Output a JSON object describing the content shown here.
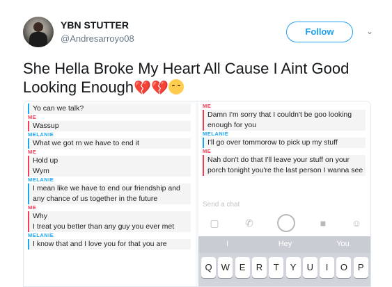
{
  "author": {
    "display_name": "YBN STUTTER",
    "handle": "@Andresarroyo08"
  },
  "follow_label": "Follow",
  "tweet": {
    "text": "She Hella Broke My Heart All Cause I Aint Good Looking Enough"
  },
  "left_chat": [
    {
      "sender": "",
      "role": "melanie",
      "text": "Yo can we talk?"
    },
    {
      "sender": "ME",
      "role": "me",
      "text": "Wassup"
    },
    {
      "sender": "MELANIE",
      "role": "melanie",
      "text": "What we got rn we have to end it"
    },
    {
      "sender": "ME",
      "role": "me",
      "text": "Hold up"
    },
    {
      "sender": "",
      "role": "me",
      "text": "Wym"
    },
    {
      "sender": "MELANIE",
      "role": "melanie",
      "text": "I mean like we have to end our friendship and any chance of us together in the future"
    },
    {
      "sender": "ME",
      "role": "me",
      "text": "Why"
    },
    {
      "sender": "",
      "role": "me",
      "text": "I treat you better than any guy you ever met"
    },
    {
      "sender": "MELANIE",
      "role": "melanie",
      "text": "I know that and I love you for that you are"
    }
  ],
  "right_chat": [
    {
      "sender": "ME",
      "role": "me",
      "text": "Damn I'm sorry that I couldn't be goo looking enough for you"
    },
    {
      "sender": "MELANIE",
      "role": "melanie",
      "text": "I'll go over tommorow to pick up my stuff"
    },
    {
      "sender": "ME",
      "role": "me",
      "text": "Nah don't do that I'll leave your stuff on your porch tonight you're the last person I wanna see"
    }
  ],
  "send_placeholder": "Send a chat",
  "suggestions": [
    "I",
    "Hey",
    "You"
  ],
  "keys": [
    "Q",
    "W",
    "E",
    "R",
    "T",
    "Y",
    "U",
    "I",
    "O",
    "P"
  ]
}
